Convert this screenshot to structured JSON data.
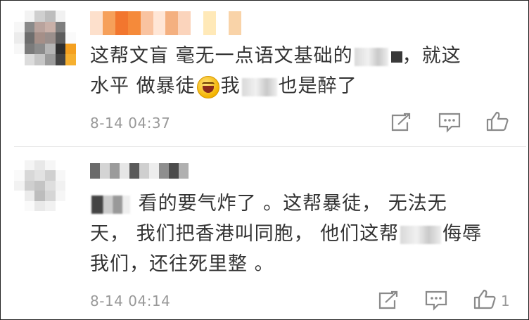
{
  "comments": [
    {
      "text_part1": "这帮文盲 毫无一点语文基础的",
      "text_part2": "，就这",
      "text_part3": "水平 做暴徒",
      "text_part4": "我",
      "text_part5": "也是醉了",
      "time": "8-14 04:37",
      "like_count": ""
    },
    {
      "text_part1": " 看的要气炸了 。这帮暴徒， 无法无",
      "text_part2": "天， 我们把香港叫同胞， 他们这帮",
      "text_part3": "侮辱",
      "text_part4": "我们，还往死里整 。",
      "time": "8-14 04:14",
      "like_count": "1"
    }
  ],
  "icons": {
    "share": "share-icon",
    "comment": "comment-icon",
    "like": "thumbs-up-icon"
  },
  "colors": {
    "text": "#333333",
    "meta": "#999999",
    "icon": "#8a8a8a",
    "emoji": "#f4b400"
  }
}
